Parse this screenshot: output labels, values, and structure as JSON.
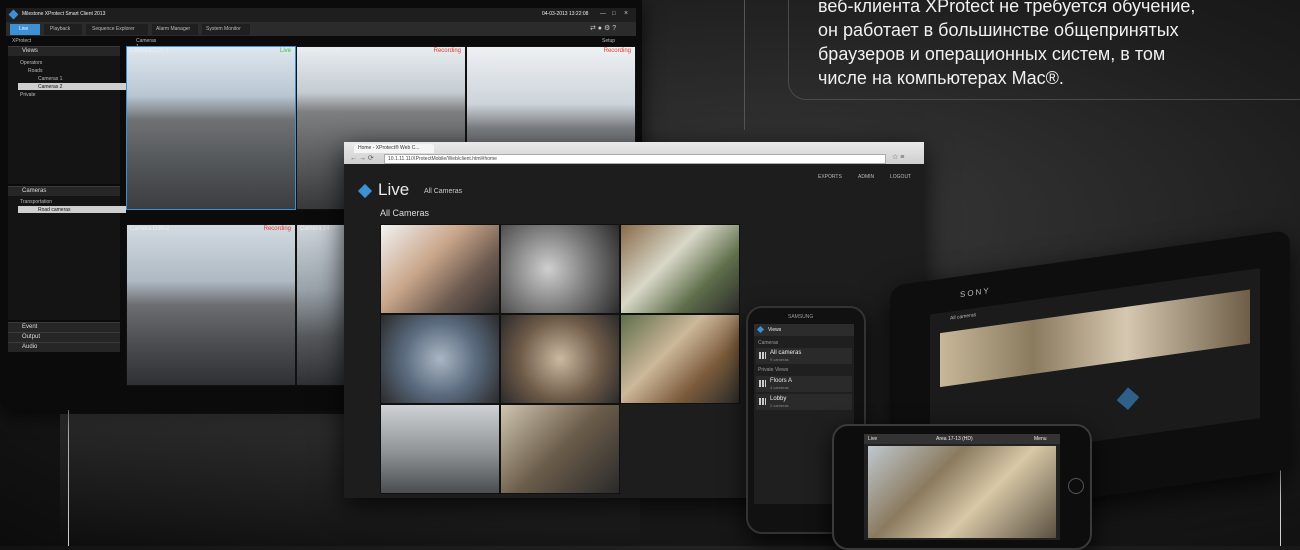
{
  "promo": {
    "line1": "веб-клиента XProtect не требуется обучение,",
    "line2": "он работает в большинстве общепринятых",
    "line3": "браузеров и операционных систем, в том",
    "line4": "числе на компьютерах Mac®."
  },
  "smartclient": {
    "title": "Milestone XProtect Smart Client 2013",
    "datetime": "04-03-2013 13:22:08",
    "tabs": [
      "Live",
      "Playback",
      "Sequence Explorer",
      "Alarm Manager",
      "System Monitor"
    ],
    "product_label": "XProtect",
    "view_selector": "Cameras 1",
    "setup_label": "Setup",
    "views_panel": {
      "header": "Views",
      "tree": [
        "Operators",
        "Roads",
        "Cameras 1",
        "Cameras 2",
        "Private"
      ]
    },
    "cameras_panel": {
      "header": "Cameras",
      "tree": [
        "Transportation",
        "Road cameras"
      ]
    },
    "panels_bottom": [
      "Event",
      "Output",
      "Audio"
    ],
    "cams": [
      {
        "name": "Camera C07-1",
        "status": "Live"
      },
      {
        "name": "Camera D12-3",
        "status": "Recording"
      },
      {
        "name": "Camera C14-2",
        "status": "Recording"
      },
      {
        "name": "Camera D30-2",
        "status": "Recording"
      },
      {
        "name": "Camera 24",
        "status": ""
      }
    ]
  },
  "webclient": {
    "tab_title": "Home - XProtect® Web C...",
    "url": "10.1.11.11/XProtectMobile/Web/client.html#home",
    "top_links": [
      "EXPORTS",
      "ADMIN",
      "LOGOUT"
    ],
    "heading": "Live",
    "heading_sub": "All Cameras",
    "subheading": "All Cameras"
  },
  "phone": {
    "brand": "SAMSUNG",
    "header": "Views",
    "section1": "Cameras",
    "items": [
      {
        "title": "All cameras",
        "sub": "9 cameras"
      },
      {
        "title": "Floors A",
        "sub": "4 cameras"
      },
      {
        "title": "Lobby",
        "sub": "2 cameras"
      }
    ],
    "section2": "Private Views"
  },
  "tablet": {
    "brand": "SONY",
    "header": "All cameras"
  },
  "iphone": {
    "back": "Live",
    "title": "Area 17-13 (HD)",
    "menu": "Menu"
  },
  "colors": {
    "accent_blue": "#3d8fd6",
    "live_green": "#3fbf3f",
    "recording_red": "#e03a2a"
  }
}
